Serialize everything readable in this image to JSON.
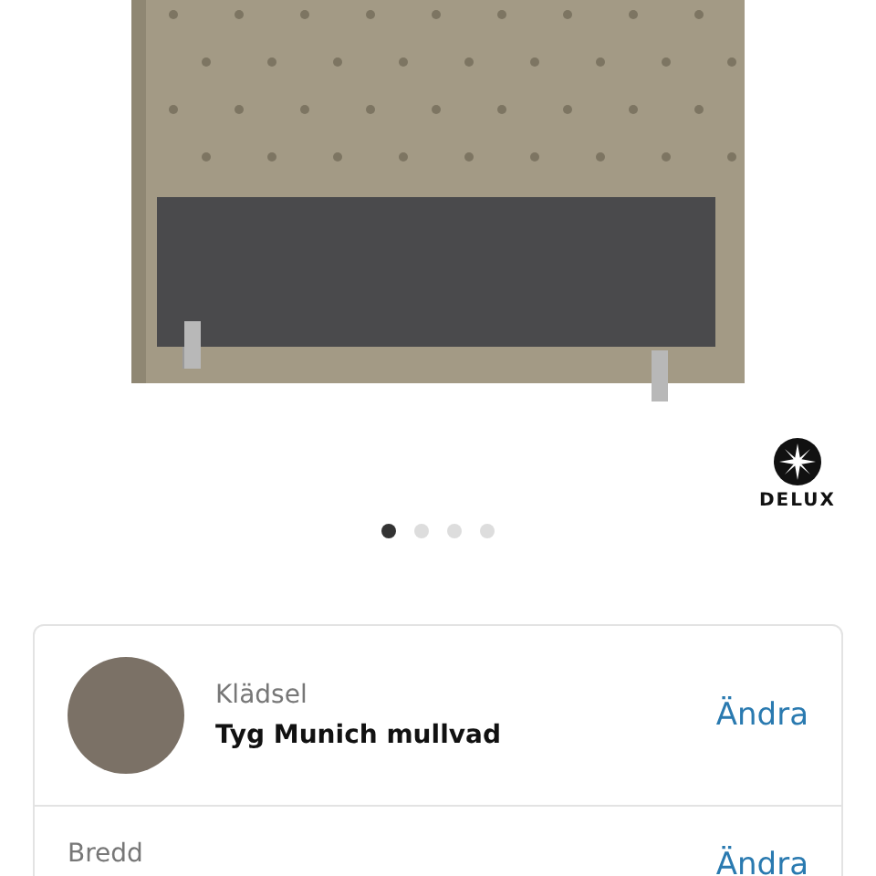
{
  "brand": "DELUX",
  "carousel_dots": [
    {
      "selected": true
    },
    {
      "selected": false
    },
    {
      "selected": false
    },
    {
      "selected": false
    }
  ],
  "options": [
    {
      "kind": "swatch",
      "label": "Klädsel",
      "value": "Tyg Munich mullvad",
      "action": "Ändra"
    },
    {
      "kind": "plain",
      "label": "Bredd",
      "action": "Ändra"
    }
  ]
}
